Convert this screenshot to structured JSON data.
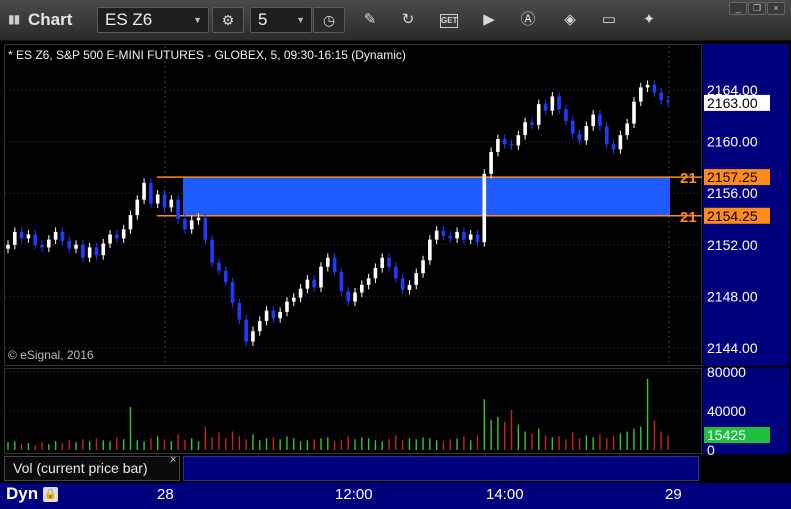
{
  "window": {
    "title": "Chart",
    "icon": "chart-window-icon",
    "controls": [
      "minimize",
      "restore",
      "close"
    ]
  },
  "toolbar": {
    "symbol": "ES Z6",
    "interval": "5",
    "tools": [
      "settings-icon",
      "clock-icon",
      "pencil-icon",
      "refresh-icon",
      "get-icon",
      "play-icon",
      "alert-icon",
      "tag-icon",
      "comment-icon",
      "twitter-icon"
    ],
    "get_label": "GET"
  },
  "chart": {
    "header": "* ES Z6, S&P 500 E-MINI FUTURES - GLOBEX, 5, 09:30-16:15 (Dynamic)",
    "copyright": "© eSignal, 2016",
    "price_labels": [
      "2164.00",
      "2160.00",
      "2156.00",
      "2152.00",
      "2148.00",
      "2144.00"
    ],
    "current_price": "2163.00",
    "zone_upper": "2157.25",
    "zone_lower": "2154.25",
    "zone_marker": "21",
    "volume_labels": [
      "80000",
      "40000",
      "0"
    ],
    "current_volume": "15425",
    "volume_title": "Vol (current price bar)",
    "volume_close": "×",
    "time_labels": [
      "28",
      "12:00",
      "14:00",
      "29"
    ],
    "dyn_label": "Dyn",
    "colors": {
      "up": "#ffffff",
      "down": "#1e3cff",
      "zone_fill": "#1f5cff",
      "zone_line": "#ff8c1a",
      "axis_bg": "#00007f",
      "vol_up": "#2ecc2e",
      "vol_down": "#d21e1e",
      "current_volume_bg": "#1fbf3f"
    }
  },
  "chart_data": {
    "type": "candlestick",
    "title": "ES Z6, S&P 500 E-MINI FUTURES - GLOBEX, 5, 09:30-16:15 (Dynamic)",
    "ylim": [
      2142.5,
      2167.5
    ],
    "zone": [
      2154.25,
      2157.25
    ],
    "x_ticks": [
      "28",
      "12:00",
      "14:00",
      "29"
    ],
    "closes": [
      2152,
      2153,
      2152.5,
      2152.8,
      2152,
      2151.8,
      2152.4,
      2153,
      2152.3,
      2151.7,
      2152,
      2151,
      2151.8,
      2151.2,
      2152.1,
      2152.8,
      2152.5,
      2153.2,
      2154.3,
      2155.5,
      2156.8,
      2155.2,
      2155.9,
      2154.9,
      2155.5,
      2154,
      2153.2,
      2153.9,
      2154.1,
      2152.4,
      2150.6,
      2150,
      2149.1,
      2147.5,
      2146.2,
      2144.5,
      2145.3,
      2146.1,
      2146.9,
      2146.3,
      2146.8,
      2147.6,
      2147.9,
      2148.6,
      2149.3,
      2148.7,
      2150.3,
      2151,
      2149.9,
      2148.4,
      2147.6,
      2148.3,
      2148.9,
      2149.4,
      2150.2,
      2151,
      2150.3,
      2149.4,
      2148.5,
      2148.9,
      2149.8,
      2150.8,
      2152.4,
      2153.1,
      2152.7,
      2152.5,
      2153,
      2152.4,
      2152.8,
      2152.2,
      2157.5,
      2159.2,
      2160.2,
      2159.8,
      2159.7,
      2160.5,
      2161.5,
      2161.3,
      2162.9,
      2162.4,
      2163.5,
      2162.5,
      2161.6,
      2160.6,
      2160.1,
      2161.2,
      2162.1,
      2161.2,
      2159.8,
      2159.4,
      2160.5,
      2161.4,
      2163.1,
      2164.2,
      2164.4,
      2163.8,
      2163.2,
      2163.1
    ],
    "volume": [
      8,
      9,
      6,
      7,
      5,
      8,
      6,
      9,
      7,
      10,
      8,
      11,
      9,
      12,
      10,
      9,
      13,
      11,
      44,
      10,
      9,
      12,
      14,
      11,
      9,
      16,
      10,
      12,
      9,
      24,
      13,
      18,
      12,
      19,
      14,
      11,
      16,
      10,
      12,
      13,
      11,
      14,
      12,
      9,
      10,
      11,
      12,
      13,
      9,
      10,
      14,
      11,
      13,
      12,
      10,
      9,
      11,
      15,
      10,
      12,
      11,
      13,
      12,
      10,
      9,
      11,
      12,
      14,
      10,
      15,
      52,
      31,
      34,
      29,
      41,
      26,
      19,
      17,
      22,
      15,
      13,
      14,
      11,
      18,
      12,
      15,
      13,
      16,
      12,
      14,
      17,
      19,
      22,
      24,
      73,
      30,
      19,
      15
    ]
  }
}
